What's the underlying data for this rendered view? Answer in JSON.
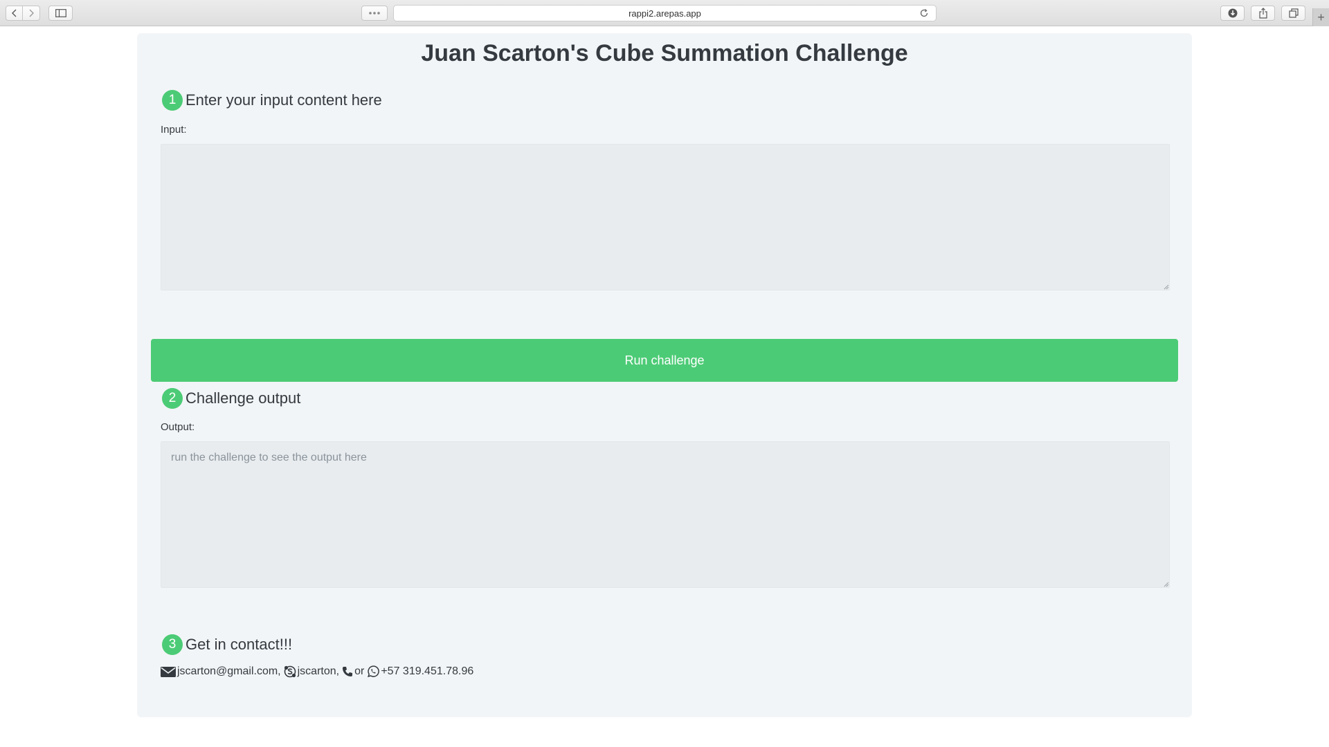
{
  "browser": {
    "url": "rappi2.arepas.app"
  },
  "page": {
    "title": "Juan Scarton's Cube Summation Challenge"
  },
  "steps": [
    {
      "number": "1",
      "heading": "Enter your input content here",
      "label": "Input:",
      "value": "",
      "placeholder": ""
    },
    {
      "number": "2",
      "heading": "Challenge output",
      "label": "Output:",
      "value": "",
      "placeholder": "run the challenge to see the output here"
    },
    {
      "number": "3",
      "heading": "Get in contact!!!"
    }
  ],
  "run_button": {
    "label": "Run challenge"
  },
  "contact": {
    "email": "jscarton@gmail.com,",
    "skype": "jscarton,",
    "or_text": "or",
    "phone": "+57 319.451.78.96"
  },
  "colors": {
    "accent": "#4ccb76",
    "card_bg": "#f2f5f7",
    "field_bg": "#e8ecef",
    "text": "#343a40"
  },
  "icons": [
    "back-icon",
    "forward-icon",
    "sidebar-icon",
    "more-icon",
    "reload-icon",
    "download-icon",
    "share-icon",
    "tabs-icon",
    "plus-icon",
    "envelope-icon",
    "skype-icon",
    "phone-icon",
    "whatsapp-icon"
  ]
}
